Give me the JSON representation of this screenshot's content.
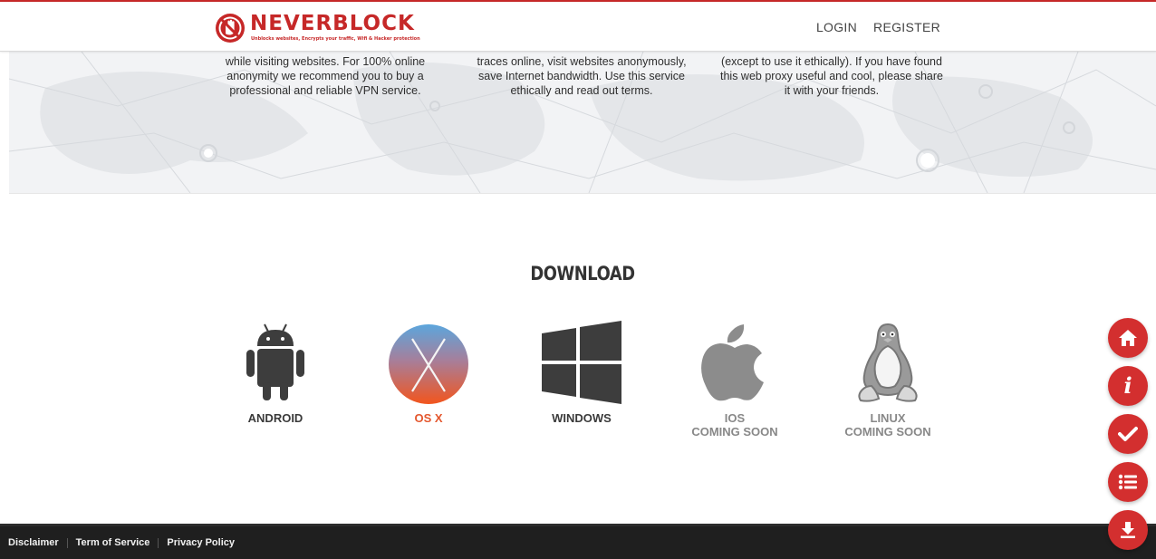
{
  "brand": {
    "name": "NEVERBLOCK",
    "tagline": "Unblocks websites, Encrypts your traffic, Wifi & Hacker protection",
    "color": "#c62828"
  },
  "nav": {
    "login": "LOGIN",
    "register": "REGISTER"
  },
  "features": [
    {
      "lines": [
        "while visiting websites. For 100% online",
        "anonymity we recommend you to buy a",
        "professional and reliable VPN service."
      ]
    },
    {
      "lines": [
        "traces online, visit websites anonymously,",
        "save Internet bandwidth. Use this service",
        "ethically and read out terms."
      ]
    },
    {
      "lines": [
        "(except to use it ethically). If you have found",
        "this web proxy useful and cool, please share",
        "it with your friends."
      ]
    }
  ],
  "download": {
    "title": "DOWNLOAD",
    "platforms": [
      {
        "label": "ANDROID",
        "sub": "",
        "icon": "android-icon"
      },
      {
        "label": "OS X",
        "sub": "",
        "icon": "osx-icon"
      },
      {
        "label": "WINDOWS",
        "sub": "",
        "icon": "windows-icon"
      },
      {
        "label": "IOS",
        "sub": "COMING SOON",
        "icon": "apple-icon"
      },
      {
        "label": "LINUX",
        "sub": "COMING SOON",
        "icon": "linux-icon"
      }
    ]
  },
  "footer": {
    "links": [
      "Disclaimer",
      "Term of Service",
      "Privacy Policy"
    ]
  },
  "side_buttons": [
    "home-icon",
    "info-icon",
    "check-icon",
    "list-icon",
    "download-icon"
  ],
  "colors": {
    "accent": "#d32f2f",
    "osx_label": "#e4572e",
    "footer_bg": "#1f1f1f"
  }
}
